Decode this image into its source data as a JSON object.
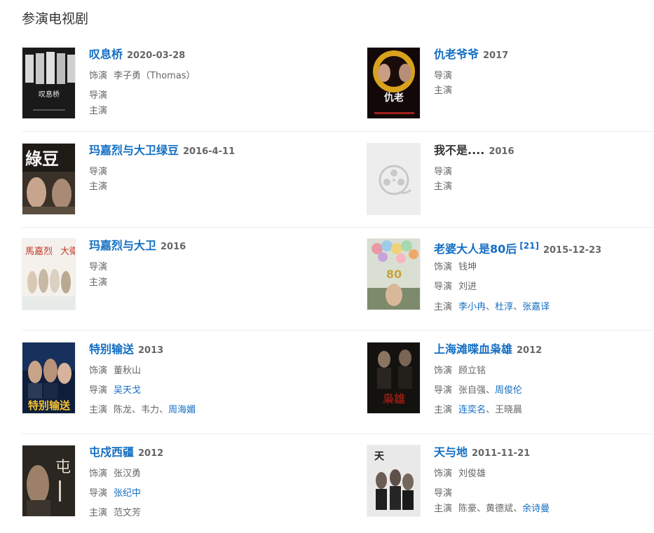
{
  "section": {
    "title": "参演电视剧"
  },
  "roles": {
    "actor": "饰演",
    "director": "导演",
    "cast": "主演",
    "sep": "、"
  },
  "dramas": [
    {
      "title": "叹息桥",
      "date": "2020-03-28",
      "actor_role": "李子勇（Thomas）",
      "directors": [],
      "cast": []
    },
    {
      "title": "仇老爷爷",
      "date": "2017",
      "actor_role": "",
      "directors": [],
      "cast": []
    },
    {
      "title": "玛嘉烈与大卫绿豆",
      "date": "2016-4-11",
      "directors": [],
      "cast": []
    },
    {
      "title": "我不是....",
      "date": "2016",
      "directors": [],
      "cast": []
    },
    {
      "title": "玛嘉烈与大卫",
      "date": "2016",
      "directors": [],
      "cast": []
    },
    {
      "title": "老婆大人是80后",
      "sup": "[21]",
      "date": "2015-12-23",
      "actor_role": "钱坤",
      "directors": [
        "刘进"
      ],
      "cast": [
        "李小冉",
        "杜淳",
        "张嘉译"
      ]
    },
    {
      "title": "特别输送",
      "date": "2013",
      "actor_role": "董秋山",
      "directors": [
        "吴天戈"
      ],
      "cast": [
        "陈龙",
        "韦力",
        "周海媚"
      ]
    },
    {
      "title": "上海滩喋血枭雄",
      "date": "2012",
      "actor_role": "顾立铭",
      "directors": [
        "张自强",
        "周俊伦"
      ],
      "cast": [
        "连奕名",
        "王晓晨"
      ]
    },
    {
      "title": "屯戍西疆",
      "date": "2012",
      "actor_role": "张汉勇",
      "directors": [
        "张纪中"
      ],
      "cast": [
        "范文芳"
      ]
    },
    {
      "title": "天与地",
      "date": "2011-11-21",
      "actor_role": "刘俊雄",
      "directors": [],
      "cast": [
        "陈豪",
        "黄德斌",
        "余诗曼"
      ]
    }
  ],
  "colors": {
    "link": "#136ec2",
    "muted": "#666666",
    "divider": "#ececec"
  }
}
